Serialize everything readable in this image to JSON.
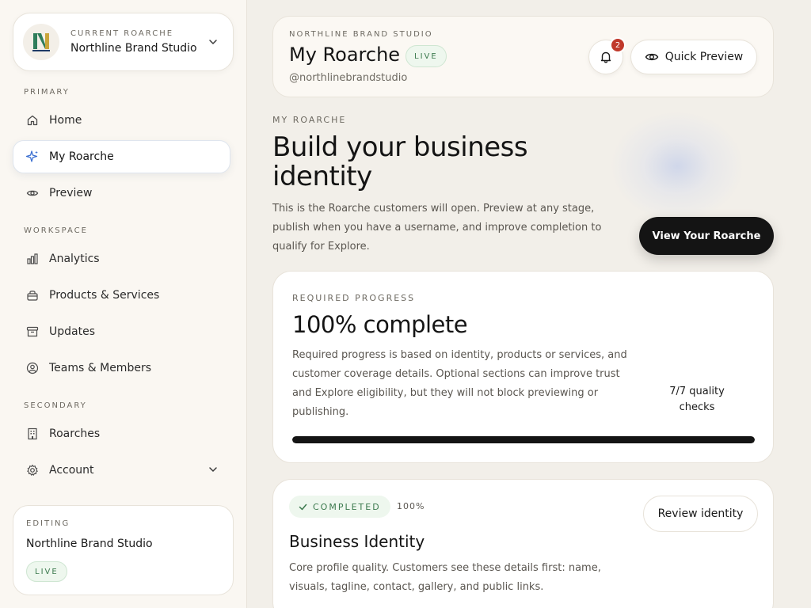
{
  "switcher": {
    "eyebrow": "CURRENT ROARCHE",
    "name": "Northline Brand Studio"
  },
  "nav": {
    "primary_label": "PRIMARY",
    "workspace_label": "WORKSPACE",
    "secondary_label": "SECONDARY",
    "items": [
      {
        "label": "Home",
        "icon": "home-icon"
      },
      {
        "label": "My Roarche",
        "icon": "sparkle-icon",
        "active": true
      },
      {
        "label": "Preview",
        "icon": "eye-icon"
      },
      {
        "label": "Analytics",
        "icon": "bar-chart-icon"
      },
      {
        "label": "Products & Services",
        "icon": "bag-icon"
      },
      {
        "label": "Updates",
        "icon": "archive-icon"
      },
      {
        "label": "Teams & Members",
        "icon": "user-circle-icon"
      },
      {
        "label": "Roarches",
        "icon": "building-icon"
      },
      {
        "label": "Account",
        "icon": "gear-icon"
      }
    ]
  },
  "editing": {
    "eyebrow": "EDITING",
    "name": "Northline Brand Studio",
    "status": "LIVE"
  },
  "header": {
    "eyebrow": "NORTHLINE BRAND STUDIO",
    "title": "My Roarche",
    "status": "LIVE",
    "handle": "@northlinebrandstudio",
    "notification_count": "2",
    "quick_preview_label": "Quick Preview"
  },
  "hero": {
    "eyebrow": "MY ROARCHE",
    "title": "Build your business identity",
    "description": "This is the Roarche customers will open. Preview at any stage, publish when you have a username, and improve completion to qualify for Explore.",
    "cta_label": "View Your Roarche"
  },
  "progress": {
    "eyebrow": "REQUIRED PROGRESS",
    "title": "100% complete",
    "description": "Required progress is based on identity, products or services, and customer coverage details. Optional sections can improve trust and Explore eligibility, but they will not block previewing or publishing.",
    "quality_checks": "7/7 quality checks",
    "percent": 100
  },
  "identity": {
    "status": "COMPLETED",
    "percent_label": "100%",
    "review_label": "Review identity",
    "title": "Business Identity",
    "description": "Core profile quality. Customers see these details first: name, visuals, tagline, contact, gallery, and public links."
  },
  "colors": {
    "accent_blue": "#3b6fd1",
    "live_green": "#3c7a4e",
    "badge_red": "#c0392b",
    "dark": "#141414"
  }
}
